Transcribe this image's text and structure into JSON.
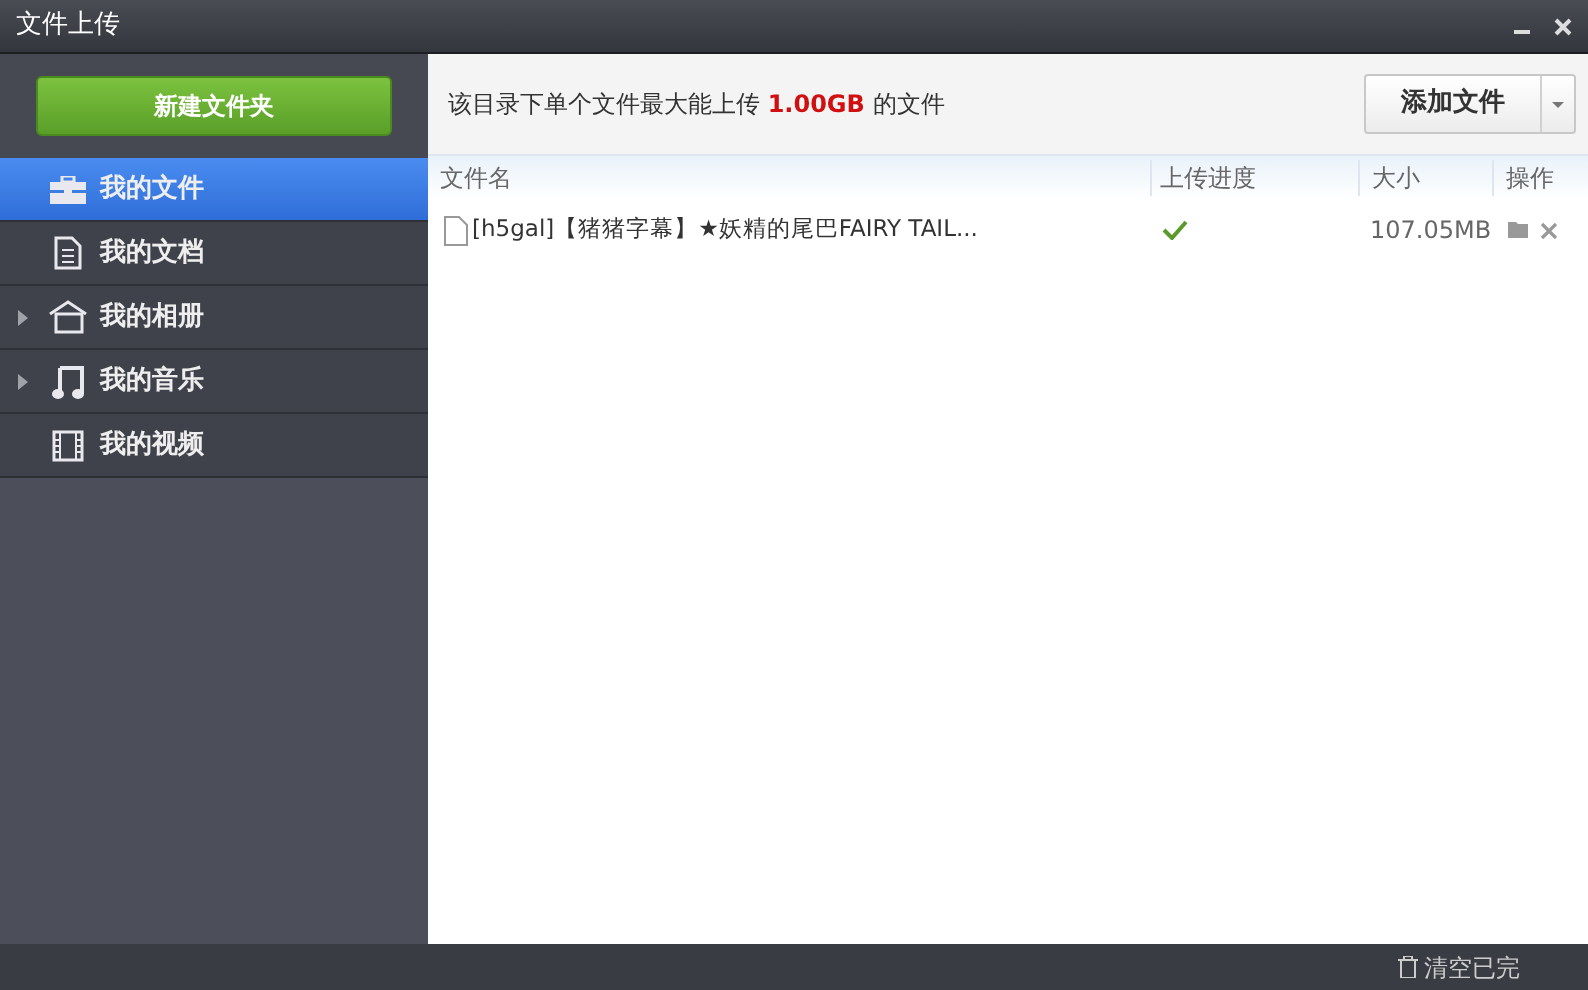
{
  "window": {
    "title": "文件上传"
  },
  "sidebar": {
    "new_folder_button": "新建文件夹",
    "items": [
      {
        "label": "我的文件",
        "kind": "briefcase",
        "selected": true,
        "has_children": false
      },
      {
        "label": "我的文档",
        "kind": "document",
        "selected": false,
        "has_children": false
      },
      {
        "label": "我的相册",
        "kind": "album",
        "selected": false,
        "has_children": true
      },
      {
        "label": "我的音乐",
        "kind": "music",
        "selected": false,
        "has_children": true
      },
      {
        "label": "我的视频",
        "kind": "video",
        "selected": false,
        "has_children": false
      }
    ]
  },
  "notice": {
    "before": "该目录下单个文件最大能上传",
    "limit": "1.00GB",
    "after": "的文件"
  },
  "add_button": "添加文件",
  "table": {
    "columns": [
      "文件名",
      "上传进度",
      "大小",
      "操作"
    ],
    "rows": [
      {
        "name": "[h5gal]【猪猪字幕】★妖精的尾巴FAIRY TAIL...",
        "done": true,
        "size": "107.05MB"
      }
    ]
  },
  "status_bar": {
    "clear_button": "清空已完"
  }
}
